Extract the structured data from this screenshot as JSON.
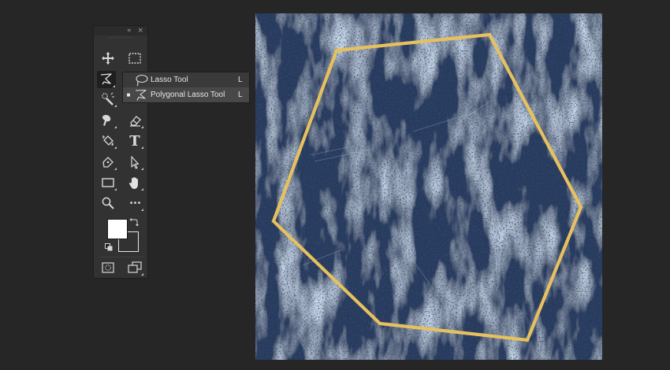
{
  "toolbox": {
    "collapse_glyph": "«",
    "close_glyph": "×",
    "tools": [
      {
        "name": "move-tool",
        "icon": "move-icon"
      },
      {
        "name": "rectangular-marquee-tool",
        "icon": "marquee-icon"
      },
      {
        "name": "polygonal-lasso-tool",
        "icon": "polygonal-lasso-icon",
        "active": true
      },
      {
        "name": "quick-selection-tool",
        "icon": "quick-selection-icon"
      },
      {
        "name": "eyedropper-tool",
        "icon": "eyedropper-icon"
      },
      {
        "name": "healing-brush-tool",
        "icon": "healing-brush-icon"
      },
      {
        "name": "eraser-tool",
        "icon": "eraser-icon"
      },
      {
        "name": "paint-bucket-tool",
        "icon": "paint-bucket-icon"
      },
      {
        "name": "type-tool",
        "icon": "type-icon"
      },
      {
        "name": "pen-tool",
        "icon": "pen-icon"
      },
      {
        "name": "path-selection-tool",
        "icon": "path-selection-icon"
      },
      {
        "name": "rectangle-tool",
        "icon": "rectangle-icon"
      },
      {
        "name": "hand-tool",
        "icon": "hand-icon"
      },
      {
        "name": "zoom-tool",
        "icon": "zoom-icon"
      },
      {
        "name": "edit-toolbar",
        "icon": "more-icon"
      },
      {
        "name": "quick-mask-mode",
        "icon": "quick-mask-icon"
      },
      {
        "name": "screen-mode",
        "icon": "screen-mode-icon"
      }
    ],
    "type_glyph": "T",
    "more_glyph": "•••",
    "foreground_color": "#ffffff",
    "background_color": "#323232"
  },
  "flyout": {
    "items": [
      {
        "label": "Lasso Tool",
        "shortcut": "L",
        "icon": "lasso-icon",
        "selected": false,
        "check": ""
      },
      {
        "label": "Polygonal Lasso Tool",
        "shortcut": "L",
        "icon": "polygonal-lasso-icon",
        "selected": true,
        "check": "■"
      }
    ]
  },
  "canvas": {
    "frame_color": "#e7c15f",
    "texture_colors": [
      "#1d2c47",
      "#3a5680",
      "#8ea8c8",
      "#0f1526"
    ]
  }
}
